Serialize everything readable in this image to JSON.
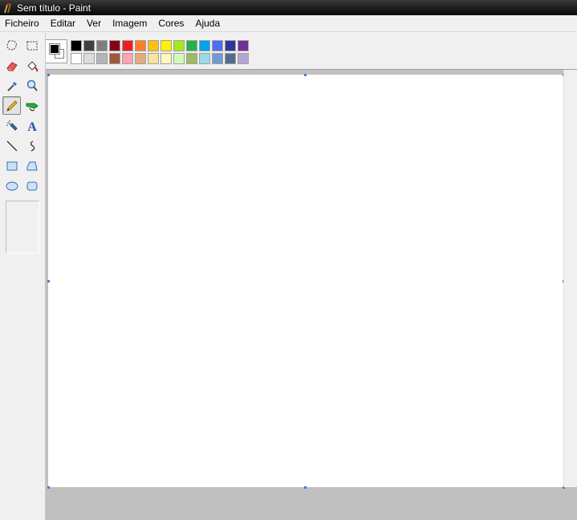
{
  "window": {
    "title": "Sem título - Paint"
  },
  "menu": {
    "items": [
      "Ficheiro",
      "Editar",
      "Ver",
      "Imagem",
      "Cores",
      "Ajuda"
    ]
  },
  "colors": {
    "foreground": "#000000",
    "background": "#ffffff",
    "palette_top": [
      "#000000",
      "#404040",
      "#7f7f7f",
      "#880015",
      "#ed1c24",
      "#ff7f27",
      "#ffc20e",
      "#fff200",
      "#a8e61d",
      "#22b14c",
      "#00a2e8",
      "#4d6df3",
      "#2f3699",
      "#6f3198"
    ],
    "palette_bottom": [
      "#ffffff",
      "#dcdcdc",
      "#b4b4b4",
      "#9c5a3c",
      "#ffa3b1",
      "#e5aa7a",
      "#f5e49c",
      "#fff9bd",
      "#d3f9bc",
      "#9dbb61",
      "#99d9ea",
      "#709ad1",
      "#546d8e",
      "#b5a5d5"
    ]
  },
  "tools": {
    "active": "pencil",
    "list": [
      "free-form-select",
      "rect-select",
      "eraser",
      "fill",
      "color-picker",
      "magnifier",
      "pencil",
      "brush",
      "airbrush",
      "text",
      "line",
      "curve",
      "rectangle",
      "polygon",
      "ellipse",
      "rounded-rectangle"
    ]
  }
}
